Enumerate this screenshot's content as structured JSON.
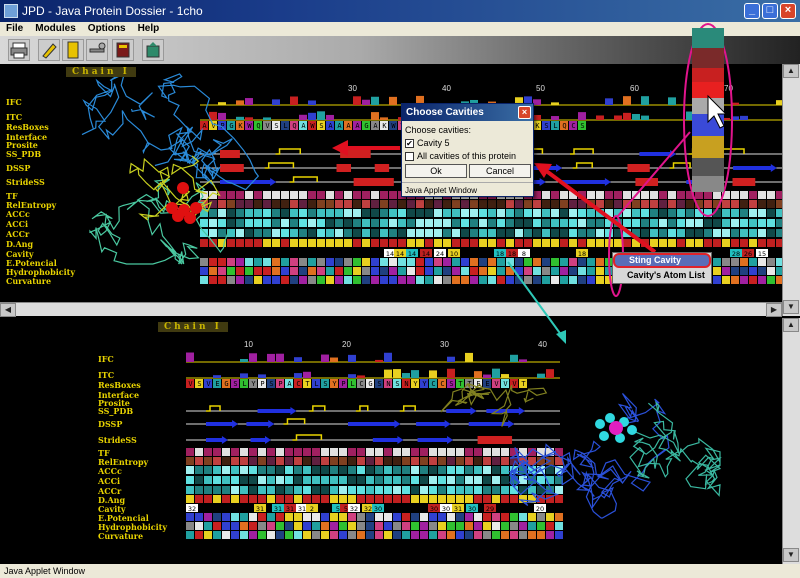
{
  "window": {
    "title": "JPD - Java Protein Dossier - 1cho"
  },
  "menu": {
    "items": [
      "File",
      "Modules",
      "Options",
      "Help"
    ]
  },
  "toolbar": {
    "tools": [
      "print-icon",
      "edit-icon",
      "document-icon",
      "tools-icon",
      "book-icon",
      "export-icon"
    ]
  },
  "top_pane": {
    "chain_label": "Chain I",
    "ticks": [
      "30",
      "40",
      "50",
      "60",
      "70"
    ],
    "rows": [
      "IFC",
      "ITC",
      "ResBoxes",
      "Interface",
      "Prosite",
      "SS_PDB",
      "DSSP",
      "StrideSS",
      "TF",
      "RelEntropy",
      "ACCc",
      "ACCi",
      "ACCr",
      "D.Ang",
      "Cavity",
      "E.Potencial",
      "Hydrophobicity",
      "Curvature"
    ],
    "resboxes": "AVPGKWQVSLQAWSAAAAGAKWVVTAAHCGVTTSGAQKSLQCS",
    "cavity_numbers": [
      "14",
      "14",
      "14",
      "14",
      "24",
      "10",
      "18",
      "18",
      "8",
      "18",
      "28",
      "26",
      "15"
    ]
  },
  "bottom_pane": {
    "chain_label": "Chain I",
    "ticks": [
      "10",
      "20",
      "30",
      "40"
    ],
    "rows": [
      "IFC",
      "ITC",
      "ResBoxes",
      "Interface",
      "Prosite",
      "SS_PDB",
      "DSSP",
      "StrideSS",
      "TF",
      "RelEntropy",
      "ACCc",
      "ACCi",
      "ACCr",
      "D.Ang",
      "Cavity",
      "E.Potencial",
      "Hydrophobicity",
      "Curvature"
    ],
    "resboxes": "VSVEGSLYPSPACTLSYPLCGSNSNYYCCSTTEEVVVT",
    "cavity_numbers": [
      "32",
      "31",
      "31",
      "31",
      "31",
      "2",
      "5",
      "5",
      "32",
      "32",
      "30",
      "30",
      "30",
      "31",
      "30",
      "29",
      "20"
    ]
  },
  "dialog": {
    "title": "Choose Cavities",
    "prompt": "Choose cavities:",
    "option_1": "Cavity 5",
    "option_2": "All cavities of this protein",
    "ok": "Ok",
    "cancel": "Cancel",
    "footer": "Java Applet Window"
  },
  "context_menu": {
    "items": [
      "Sting Cavity",
      "Cavity's Atom List"
    ]
  },
  "status": "Java Applet Window",
  "colors": {
    "label": "#e8d300",
    "annotation": "#e0148c",
    "arrow_red": "#e01020",
    "arrow_cyan": "#2ec8b8"
  }
}
